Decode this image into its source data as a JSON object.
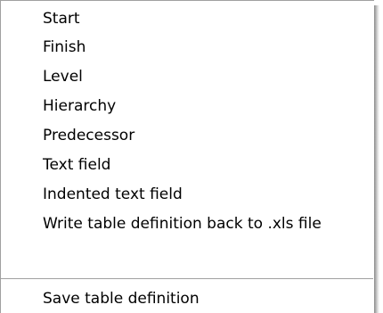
{
  "menu": {
    "items": [
      {
        "label": "Start"
      },
      {
        "label": "Finish"
      },
      {
        "label": "Level"
      },
      {
        "label": "Hierarchy"
      },
      {
        "label": "Predecessor"
      },
      {
        "label": "Text field"
      },
      {
        "label": "Indented text field"
      },
      {
        "label": "Write table definition back to .xls file"
      }
    ],
    "footer_items": [
      {
        "label": "Save table definition"
      }
    ]
  }
}
